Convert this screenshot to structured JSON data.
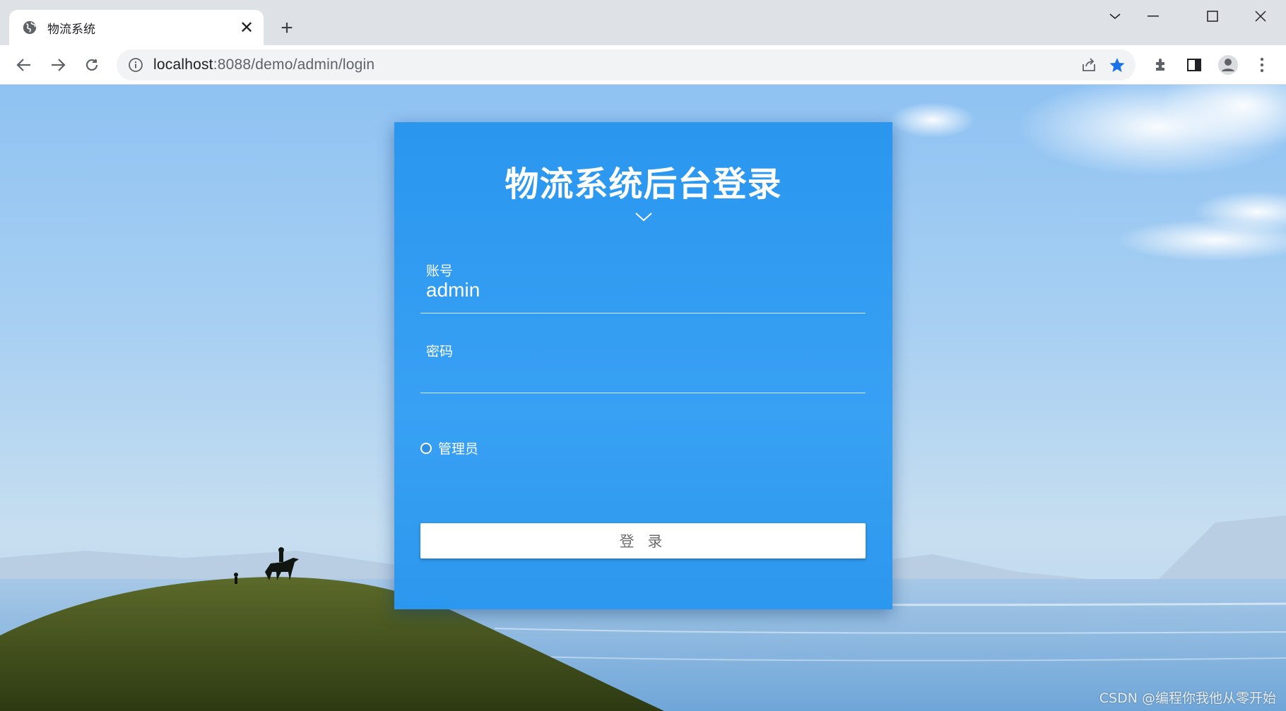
{
  "browser": {
    "tab_title": "物流系统",
    "url_host": "localhost",
    "url_rest": ":8088/demo/admin/login",
    "tab_close_glyph": "✕",
    "new_tab_glyph": "+"
  },
  "login": {
    "title": "物流系统后台登录",
    "account_label": "账号",
    "account_value": "admin",
    "password_label": "密码",
    "password_value": "",
    "role_option": "管理员",
    "role_selected": false,
    "submit_label": "登 录"
  },
  "watermark": "CSDN @编程你我他从零开始",
  "colors": {
    "card": "#2f98f0",
    "active_star": "#1a73e8"
  }
}
